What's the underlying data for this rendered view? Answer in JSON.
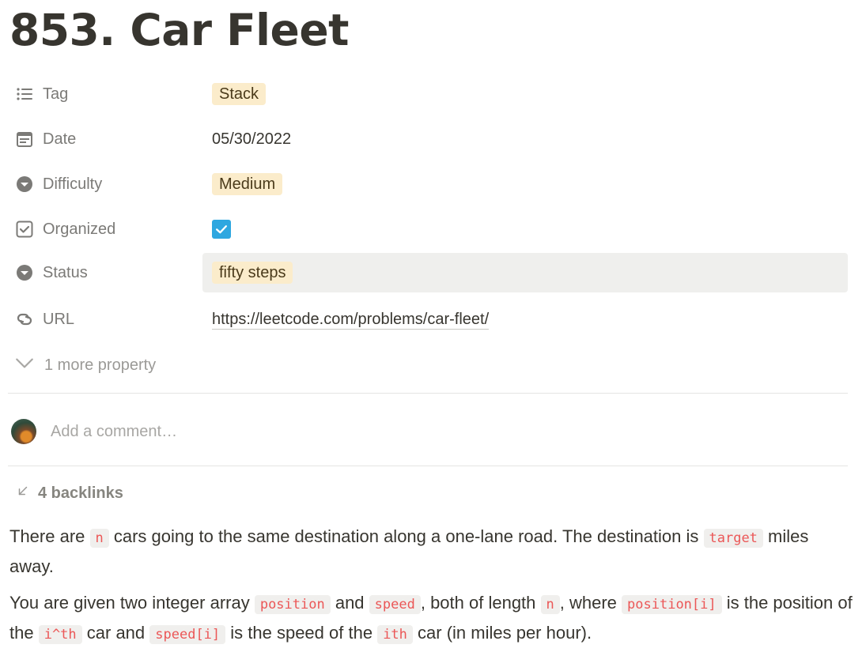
{
  "page": {
    "title": "853. Car Fleet"
  },
  "properties": {
    "tag": {
      "label": "Tag",
      "icon": "list-icon",
      "value": "Stack"
    },
    "date": {
      "label": "Date",
      "icon": "calendar-icon",
      "value": "05/30/2022"
    },
    "difficulty": {
      "label": "Difficulty",
      "icon": "select-icon",
      "value": "Medium"
    },
    "organized": {
      "label": "Organized",
      "icon": "checkbox-icon",
      "checked": true
    },
    "status": {
      "label": "Status",
      "icon": "select-icon",
      "value": "fifty steps"
    },
    "url": {
      "label": "URL",
      "icon": "link-icon",
      "value": "https://leetcode.com/problems/car-fleet/"
    }
  },
  "more_properties": {
    "label": "1 more property",
    "icon": "chevron-down-icon"
  },
  "comment": {
    "placeholder": "Add a comment…"
  },
  "backlinks": {
    "label": "4 backlinks",
    "icon": "arrow-down-left-icon"
  },
  "body": {
    "p1": {
      "t1": "There are ",
      "c1": "n",
      "t2": " cars going to the same destination along a one-lane road. The destination is ",
      "c2": "target",
      "t3": " miles away."
    },
    "p2": {
      "t1": "You are given two integer array ",
      "c1": "position",
      "t2": " and ",
      "c2": "speed",
      "t3": ", both of length ",
      "c3": "n",
      "t4": ", where ",
      "c4": "position[i]",
      "t5": " is the position of the ",
      "c5": "i^th",
      "t6": " car and ",
      "c6": "speed[i]",
      "t7": " is the speed of the ",
      "c7": "ith",
      "t8": " car (in miles per hour)."
    }
  },
  "colors": {
    "tag_bg": "#fbeccb",
    "checkbox": "#2ea7e0",
    "code_text": "#eb5757",
    "code_bg": "#f0efed"
  }
}
